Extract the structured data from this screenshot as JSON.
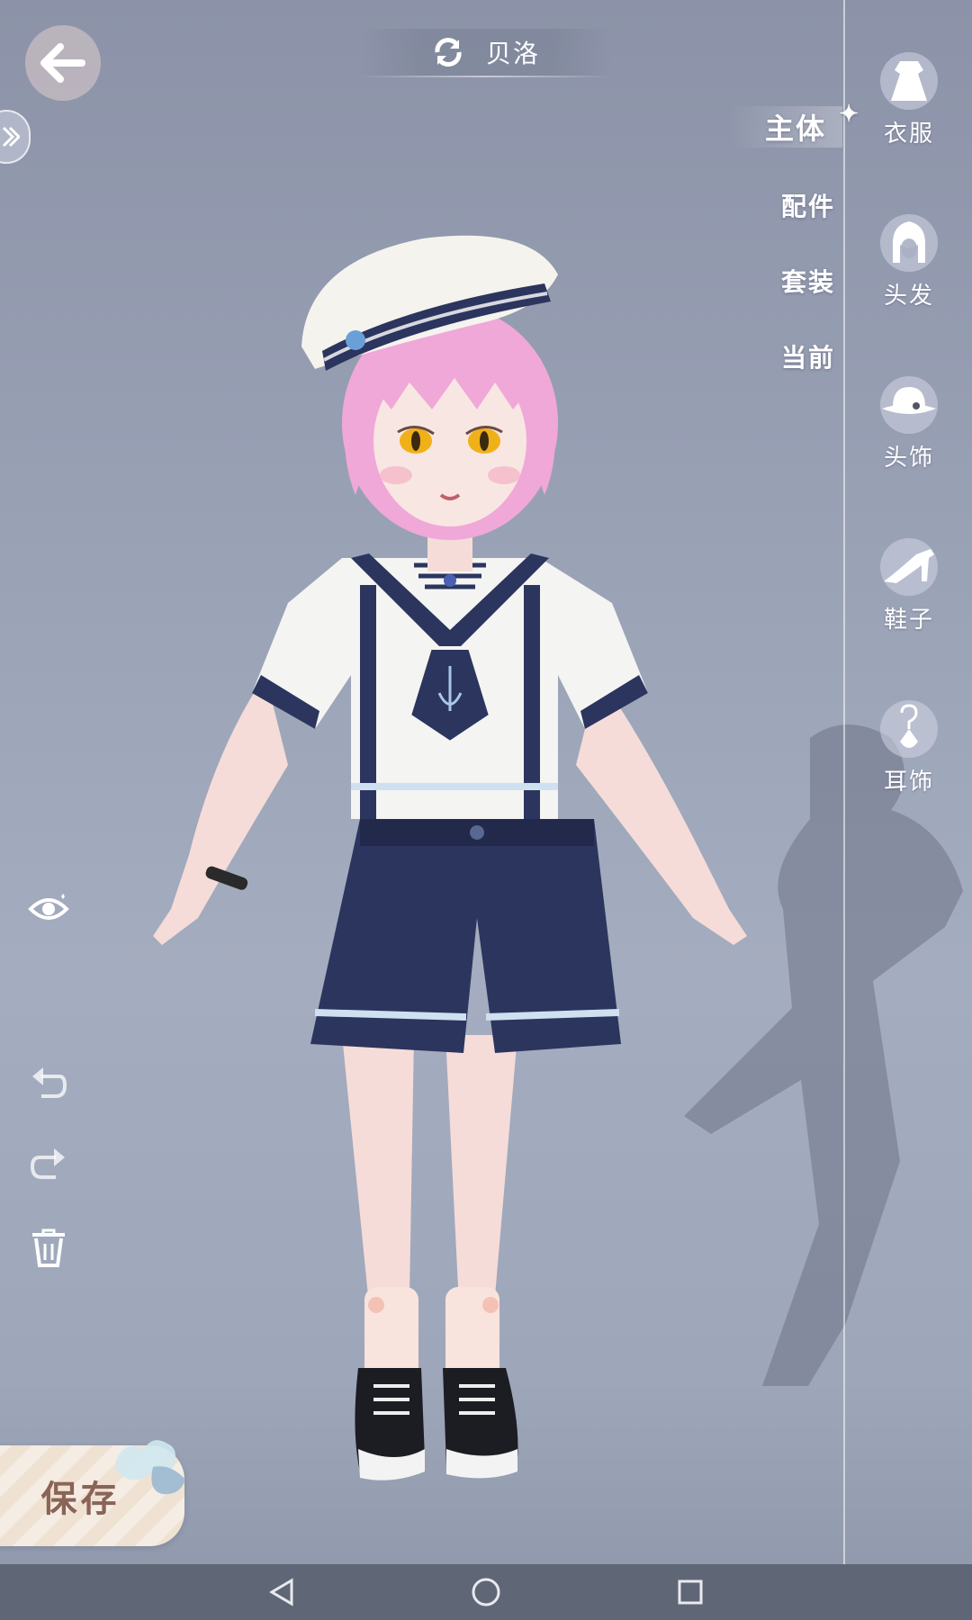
{
  "header": {
    "character_name": "贝洛"
  },
  "tabs": [
    {
      "label": "主体",
      "active": true
    },
    {
      "label": "配件",
      "active": false
    },
    {
      "label": "套装",
      "active": false
    },
    {
      "label": "当前",
      "active": false
    }
  ],
  "categories": [
    {
      "label": "衣服",
      "icon": "dress-icon"
    },
    {
      "label": "头发",
      "icon": "hair-icon"
    },
    {
      "label": "头饰",
      "icon": "hat-icon"
    },
    {
      "label": "鞋子",
      "icon": "shoe-icon"
    },
    {
      "label": "耳饰",
      "icon": "earring-icon"
    }
  ],
  "tools": [
    "eye-icon",
    "undo-icon",
    "redo-icon",
    "trash-icon"
  ],
  "save_button": {
    "label": "保存"
  },
  "navbar": [
    "back-triangle-icon",
    "home-circle-icon",
    "recents-square-icon"
  ],
  "colors": {
    "background": "#9aa2b6",
    "navbar": "#5f6676",
    "save_text": "#8a6457",
    "hair": "#f0a8d8",
    "navy": "#2d3660"
  }
}
